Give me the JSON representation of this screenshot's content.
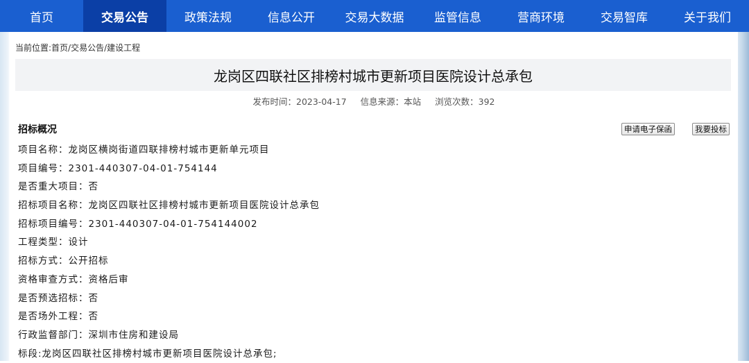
{
  "nav": {
    "items": [
      {
        "label": "首页",
        "active": false
      },
      {
        "label": "交易公告",
        "active": true
      },
      {
        "label": "政策法规",
        "active": false
      },
      {
        "label": "信息公开",
        "active": false
      },
      {
        "label": "交易大数据",
        "active": false
      },
      {
        "label": "监管信息",
        "active": false
      },
      {
        "label": "营商环境",
        "active": false
      },
      {
        "label": "交易智库",
        "active": false
      },
      {
        "label": "关于我们",
        "active": false
      }
    ]
  },
  "breadcrumb": "当前位置:首页/交易公告/建设工程",
  "page_title": "龙岗区四联社区排榜村城市更新项目医院设计总承包",
  "meta": {
    "publish_time": "发布时间：2023-04-17",
    "source": "信息来源：本站",
    "views": "浏览次数：392"
  },
  "section": {
    "heading": "招标概况"
  },
  "actions": {
    "guarantee_label": "申请电子保函",
    "bid_label": "我要投标"
  },
  "details": [
    "项目名称：龙岗区横岗街道四联排榜村城市更新单元项目",
    "项目编号：2301-440307-04-01-754144",
    "是否重大项目：否",
    "招标项目名称：龙岗区四联社区排榜村城市更新项目医院设计总承包",
    "招标项目编号：2301-440307-04-01-754144002",
    "工程类型：设计",
    "招标方式：公开招标",
    "资格审查方式：资格后审",
    "是否预选招标：否",
    "是否场外工程：否",
    "行政监督部门：深圳市住房和建设局",
    "标段:龙岗区四联社区排榜村城市更新项目医院设计总承包;"
  ],
  "colors": {
    "nav_bg": "#1a5fd0",
    "nav_active_bg": "#0b3fa6",
    "title_bar_bg": "#f2f3f5"
  }
}
